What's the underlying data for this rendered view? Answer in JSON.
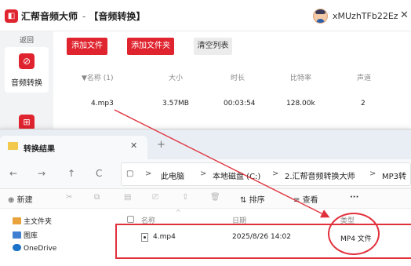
{
  "converter": {
    "logo_glyph": "◧",
    "app_name": "汇帮音频大师",
    "separator": "-",
    "module_name": "【音频转换】",
    "username": "xMUzhTFb22Ez",
    "close_glyph": "✕",
    "sidebar": {
      "back": "返回",
      "audio_icon_glyph": "⊘",
      "audio_label": "音频转换",
      "video_icon_glyph": "⊞"
    },
    "buttons": {
      "add_file": "添加文件",
      "add_folder": "添加文件夹",
      "clear_list": "清空列表"
    },
    "table": {
      "headers": {
        "name": "▼名称 (1)",
        "size": "大小",
        "duration": "时长",
        "bitrate": "比特率",
        "channels": "声道"
      },
      "rows": [
        {
          "name": "4.mp3",
          "size": "3.57MB",
          "duration": "00:03:54",
          "bitrate": "128.00k",
          "channels": "2"
        }
      ]
    }
  },
  "explorer": {
    "tab_title": "转换结果",
    "tab_close": "✕",
    "tab_add": "+",
    "nav": {
      "back": "←",
      "forward": "→",
      "up": "↑",
      "refresh": "C",
      "view_glyph": "▢"
    },
    "breadcrumb": [
      "此电脑",
      "本地磁盘 (C:)",
      "2.汇帮音频转换大师",
      "MP3转"
    ],
    "breadcrumb_sep": ">",
    "toolbar": {
      "new_glyph": "⊕",
      "new_label": "新建",
      "cut": "✂",
      "copy": "⧉",
      "paste": "▤",
      "rename": "⎚",
      "share": "⇪",
      "delete": "🗑",
      "sort_glyph": "⇅",
      "sort_label": "排序",
      "view_glyph": "≡",
      "view_label": "查看",
      "more": "···"
    },
    "navpane": [
      {
        "label": "主文件夹",
        "color": "#e8a33d"
      },
      {
        "label": "图库",
        "color": "#3f7fd1"
      },
      {
        "label": "OneDrive",
        "color": "#1a73c8"
      }
    ],
    "columns": {
      "name": "名称",
      "date": "日期",
      "type": "类型",
      "sort_caret": "^"
    },
    "files": [
      {
        "name": "4.mp4",
        "date": "2025/8/26 14:02",
        "type": "MP4 文件"
      }
    ]
  },
  "annotation_color": "#e1313c"
}
